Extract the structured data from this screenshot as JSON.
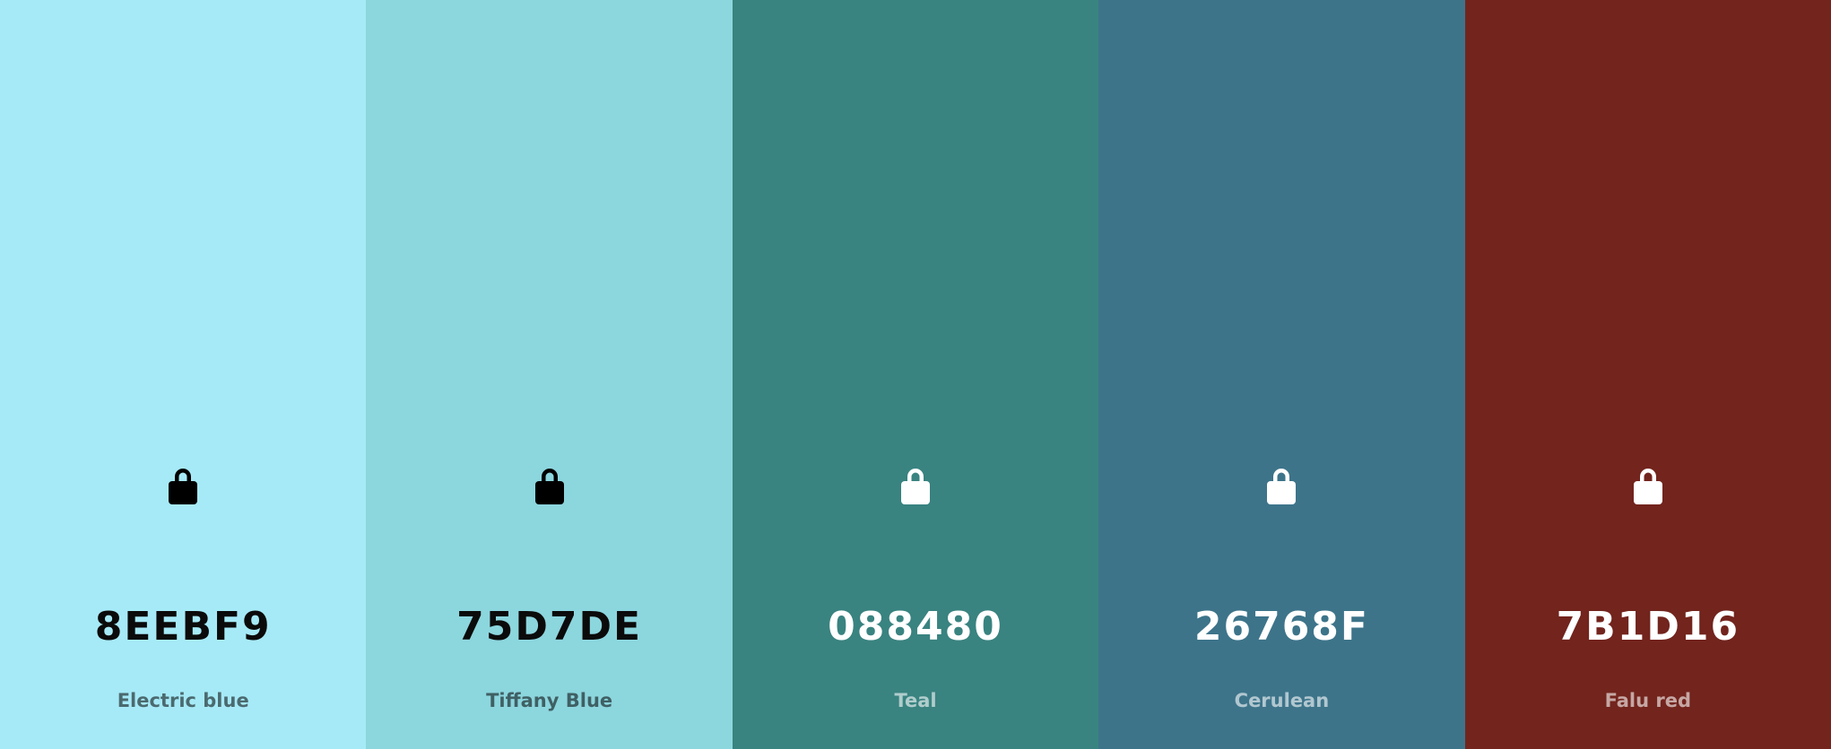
{
  "palette": {
    "colors": [
      {
        "hex": "8EEBF9",
        "name": "Electric blue",
        "swatch_color": "#A6EAF7",
        "text_theme": "dark",
        "icon": "lock-icon"
      },
      {
        "hex": "75D7DE",
        "name": "Tiffany Blue",
        "swatch_color": "#8CD6DE",
        "text_theme": "dark",
        "icon": "lock-icon"
      },
      {
        "hex": "088480",
        "name": "Teal",
        "swatch_color": "#398380",
        "text_theme": "light",
        "icon": "lock-icon"
      },
      {
        "hex": "26768F",
        "name": "Cerulean",
        "swatch_color": "#3D748A",
        "text_theme": "light",
        "icon": "lock-icon"
      },
      {
        "hex": "7B1D16",
        "name": "Falu red",
        "swatch_color": "#72241D",
        "text_theme": "light",
        "icon": "lock-icon"
      }
    ]
  }
}
